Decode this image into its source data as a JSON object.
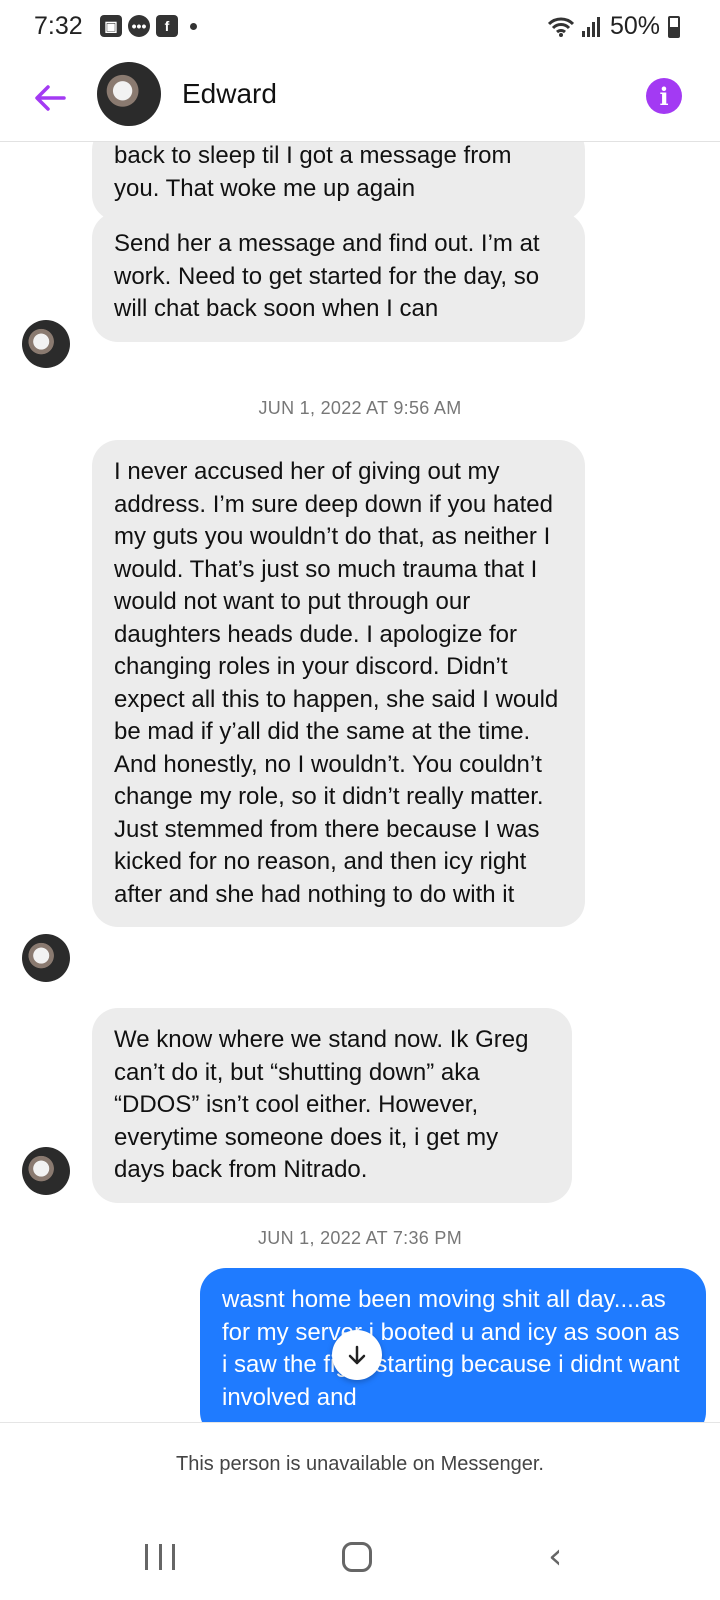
{
  "status_bar": {
    "time": "7:32",
    "battery": "50%"
  },
  "header": {
    "contact_name": "Edward"
  },
  "messages": {
    "m1": "back to sleep til I got a message from you. That woke me up again",
    "m2": "Send her a message and find out. I’m at work. Need to get started for the day, so will chat back soon when I can",
    "ts1": "JUN 1, 2022 AT 9:56 AM",
    "m3": "I never accused her of giving out my address. I’m sure deep down if you hated my guts you wouldn’t do that, as neither I would. That’s just so much trauma that I would not want to put through our daughters heads dude. I apologize for changing roles in your discord. Didn’t expect all this to happen, she said I would be mad if y’all did the same at the time. And honestly, no I wouldn’t. You couldn’t change my role, so it didn’t really matter. Just stemmed from there because I was kicked for no reason, and then icy right after and she had nothing to do with it",
    "m4": "We know where we stand now. Ik Greg can’t do it, but “shutting down” aka “DDOS” isn’t cool either. However, everytime someone does it, i get my days back from Nitrado.",
    "ts2": "JUN 1, 2022 AT 7:36 PM",
    "m5": "wasnt home been moving shit all day....as for my server i booted u and icy as soon as i saw the fight starting because i didnt want involved and"
  },
  "notice": "This person is unavailable on Messenger.",
  "icons": {
    "back": "arrow-left-icon",
    "info": "info-icon",
    "scroll": "arrow-down-icon"
  },
  "colors": {
    "accent": "#a33af3",
    "outgoing_bubble": "#1f7bff",
    "incoming_bubble": "#ececec"
  }
}
